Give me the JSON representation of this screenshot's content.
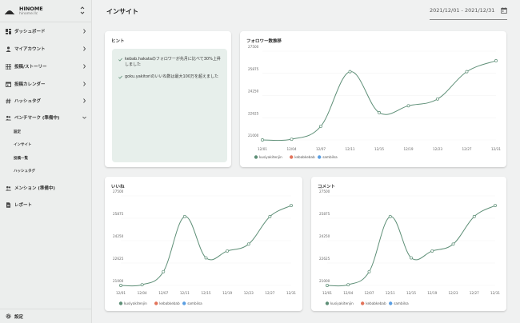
{
  "app": {
    "name": "HINOME",
    "account": "hinome.llc"
  },
  "sidebar": {
    "items": [
      {
        "label": "ダッシュボード",
        "icon": "dashboard-icon"
      },
      {
        "label": "マイアカウント",
        "icon": "account-icon"
      },
      {
        "label": "投稿/ストーリー",
        "icon": "grid-icon"
      },
      {
        "label": "投稿カレンダー",
        "icon": "calendar-icon"
      },
      {
        "label": "ハッシュタグ",
        "icon": "hashtag-icon"
      },
      {
        "label": "ベンチマーク (準備中)",
        "icon": "people-icon"
      }
    ],
    "sub_items": [
      "設定",
      "インサイト",
      "投稿一覧",
      "ハッシュタグ"
    ],
    "items2": [
      {
        "label": "メンション (準備中)",
        "icon": "people-icon"
      },
      {
        "label": "レポート",
        "icon": "document-icon"
      }
    ],
    "settings_label": "設定"
  },
  "header": {
    "title": "インサイト",
    "date_range": "2021/12/01 - 2021/12/31"
  },
  "hint": {
    "title": "ヒント",
    "items": [
      "kebab.hakataのフォロワーが先月に比べて30%上昇しました",
      "goku.yakitoriのいいね数は最大100万を超えました"
    ]
  },
  "colors": {
    "accent": "#5e8f77",
    "series": [
      "#5e8f77",
      "#e2735a",
      "#5a9ee2"
    ]
  },
  "chart_data": [
    {
      "type": "line",
      "title": "フォロワー数推移",
      "x": [
        "12/01",
        "12/04",
        "12/07",
        "12/11",
        "12/15",
        "12/19",
        "12/23",
        "12/27",
        "12/31"
      ],
      "y_ticks": [
        "21000",
        "22625",
        "24250",
        "25875",
        "27500"
      ],
      "ylim": [
        21000,
        27500
      ],
      "series": [
        {
          "name": "kusiyakitenjin",
          "values": [
            21000,
            21050,
            22000,
            26000,
            23000,
            23500,
            24000,
            26000,
            26800
          ]
        }
      ],
      "legend": [
        "kusiyakitenjin",
        "kebabkebab",
        "sambilsa"
      ],
      "legend_position": "bottom-left"
    },
    {
      "type": "line",
      "title": "いいね",
      "x": [
        "12/01",
        "12/04",
        "12/07",
        "12/11",
        "12/15",
        "12/19",
        "12/23",
        "12/27",
        "12/31"
      ],
      "y_ticks": [
        "21000",
        "22625",
        "24250",
        "25875",
        "27500"
      ],
      "ylim": [
        21000,
        27500
      ],
      "series": [
        {
          "name": "kusiyakitenjin",
          "values": [
            21000,
            21050,
            22000,
            26000,
            23000,
            23500,
            24000,
            26000,
            26800
          ]
        }
      ],
      "legend": [
        "kusiyakitenjin",
        "kebabkebab",
        "sambilsa"
      ],
      "legend_position": "bottom-left"
    },
    {
      "type": "line",
      "title": "コメント",
      "x": [
        "12/01",
        "12/04",
        "12/07",
        "12/11",
        "12/15",
        "12/19",
        "12/23",
        "12/27",
        "12/31"
      ],
      "y_ticks": [
        "21000",
        "22625",
        "24250",
        "25875",
        "27500"
      ],
      "ylim": [
        21000,
        27500
      ],
      "series": [
        {
          "name": "kusiyakitenjin",
          "values": [
            21000,
            21050,
            22000,
            26000,
            23000,
            23500,
            24000,
            26000,
            26800
          ]
        }
      ],
      "legend": [
        "kusiyakitenjin",
        "kebabkebab",
        "sambilsa"
      ],
      "legend_position": "bottom-left"
    }
  ]
}
